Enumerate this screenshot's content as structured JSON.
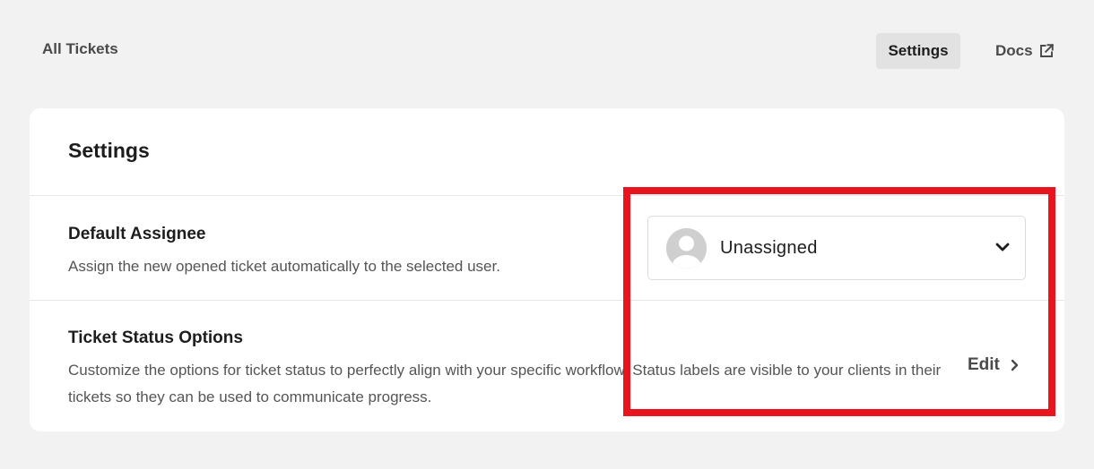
{
  "nav": {
    "all_tickets": "All Tickets",
    "settings": "Settings",
    "docs": "Docs",
    "docs_icon": "external-link-icon"
  },
  "card": {
    "title": "Settings",
    "default_assignee": {
      "title": "Default Assignee",
      "description": "Assign the new opened ticket automatically to the selected user.",
      "select_value": "Unassigned",
      "avatar_icon": "user-avatar-icon",
      "chevron_icon": "chevron-down-icon"
    },
    "ticket_status": {
      "title": "Ticket Status Options",
      "description": "Customize the options for ticket status to perfectly align with your specific workflow. Status labels are visible to your clients in their tickets so they can be used to communicate progress.",
      "edit_label": "Edit",
      "edit_icon": "chevron-right-icon"
    }
  },
  "colors": {
    "background": "#f2f2f2",
    "card": "#ffffff",
    "highlight": "#e8141e",
    "active_tab": "#e2e2e2"
  }
}
